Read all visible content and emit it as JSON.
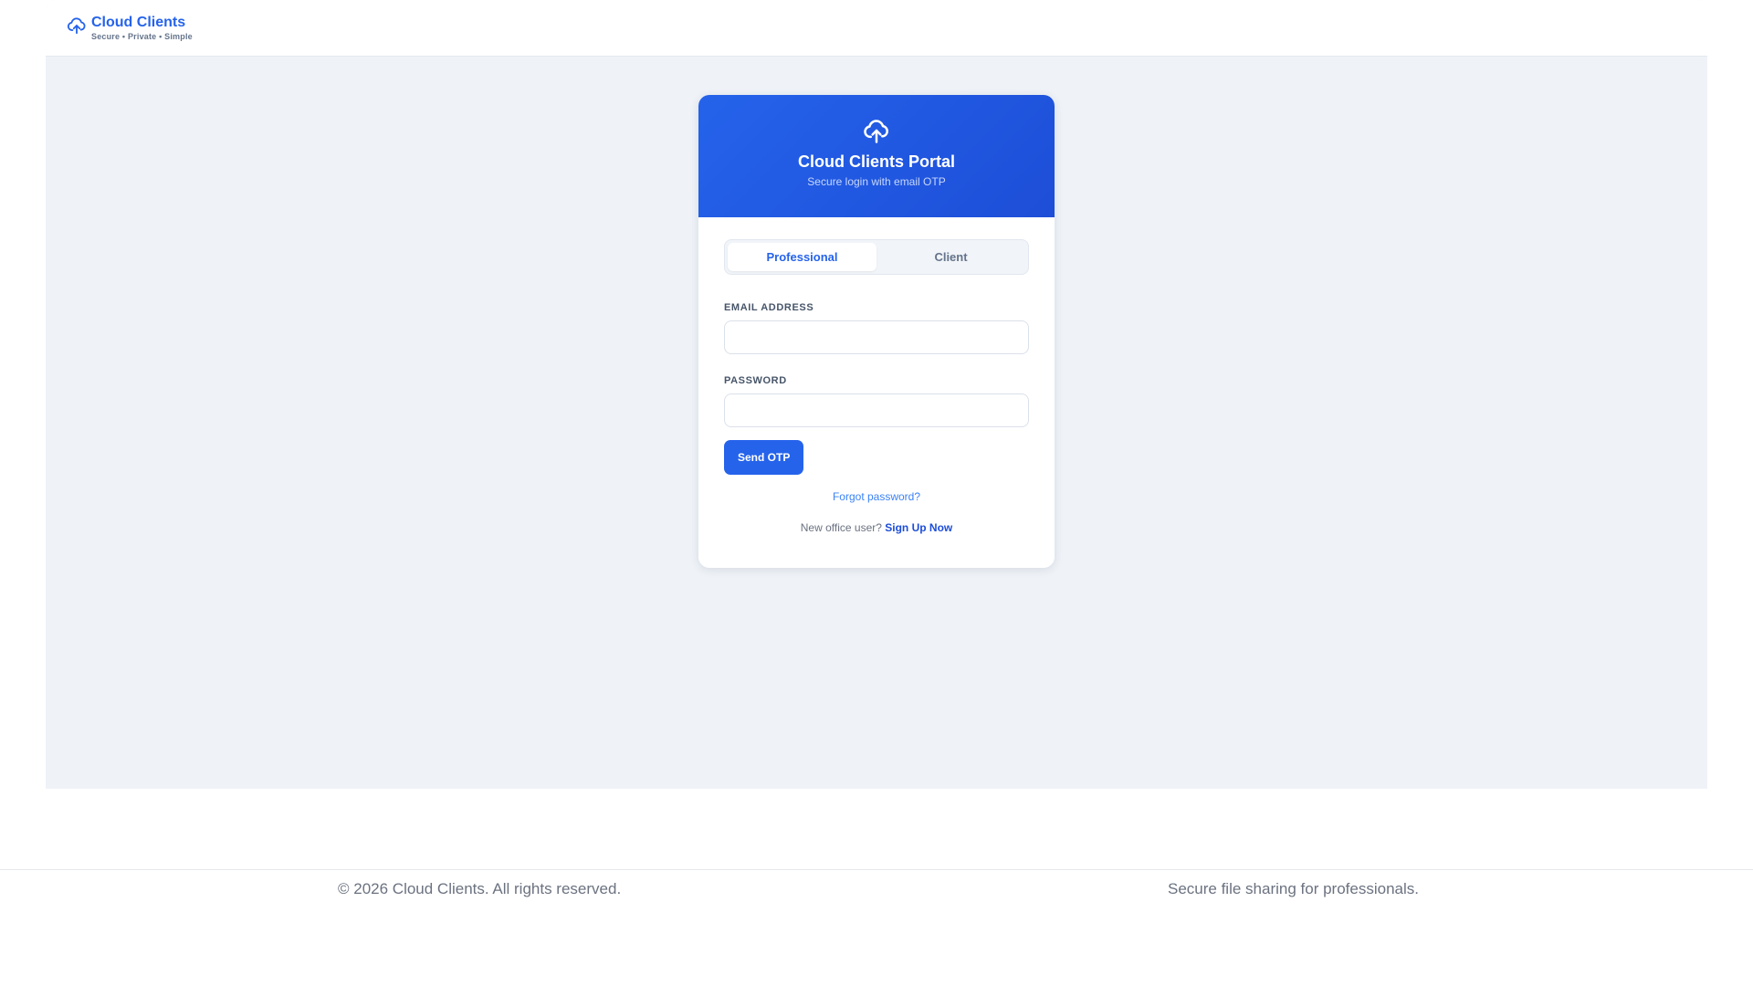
{
  "header": {
    "brand_name": "Cloud Clients",
    "brand_tagline": "Secure • Private • Simple",
    "brand_icon": "cloud-upload-icon"
  },
  "login_card": {
    "icon": "cloud-upload-icon",
    "title": "Cloud Clients Portal",
    "subtitle": "Secure login with email OTP",
    "tabs": [
      {
        "label": "Professional",
        "active": true
      },
      {
        "label": "Client",
        "active": false
      }
    ],
    "email": {
      "label": "EMAIL ADDRESS",
      "value": "",
      "placeholder": ""
    },
    "password": {
      "label": "PASSWORD",
      "value": "",
      "placeholder": ""
    },
    "submit_label": "Send OTP",
    "forgot_label": "Forgot password?",
    "signup_prompt": "New office user?",
    "signup_link": "Sign Up Now"
  },
  "footer": {
    "copyright": "© 2026 Cloud Clients. All rights reserved.",
    "tagline": "Secure file sharing for professionals."
  },
  "colors": {
    "primary": "#2563eb",
    "primary_dark": "#1d4ed8",
    "page_bg": "#eff3f8",
    "text_muted": "#6b7280"
  }
}
